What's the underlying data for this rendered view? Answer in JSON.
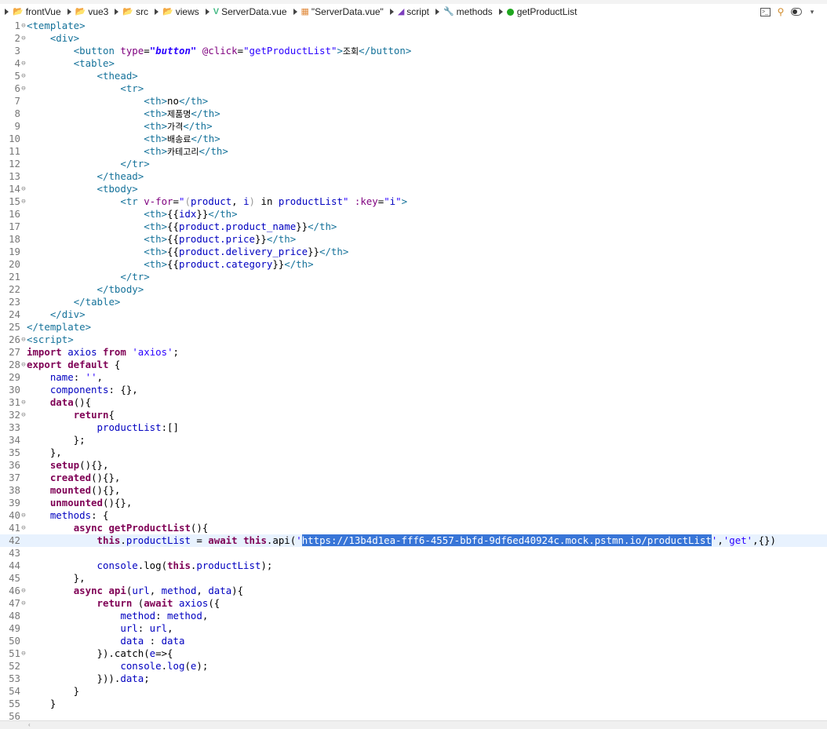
{
  "breadcrumb": {
    "items": [
      {
        "label": "frontVue",
        "icon": "folder-icon"
      },
      {
        "label": "vue3",
        "icon": "folder-icon"
      },
      {
        "label": "src",
        "icon": "folder-icon"
      },
      {
        "label": "views",
        "icon": "folder-icon"
      },
      {
        "label": "ServerData.vue",
        "icon": "vue-file-icon"
      },
      {
        "label": "\"ServerData.vue\"",
        "icon": "grid-file-icon"
      },
      {
        "label": "script",
        "icon": "script-icon"
      },
      {
        "label": "methods",
        "icon": "wrench-icon"
      },
      {
        "label": "getProductList",
        "icon": "method-icon"
      }
    ]
  },
  "toolbar": {
    "icons": [
      "terminal-icon",
      "overlay-icon",
      "toggle-icon",
      "chevron-down-icon"
    ]
  },
  "editor": {
    "current_line": 42,
    "lines": [
      {
        "n": "1",
        "fold": true,
        "html": "<span class='tok-tag'>&lt;template&gt;</span>"
      },
      {
        "n": "2",
        "fold": true,
        "html": "    <span class='tok-tag'>&lt;div&gt;</span>"
      },
      {
        "n": "3",
        "fold": false,
        "html": "        <span class='tok-tag'>&lt;button</span> <span class='tok-attr'>type</span>=<span class='tok-strit'>\"button\"</span> <span class='tok-attr'>@click</span>=<span class='tok-str'>\"getProductList\"</span><span class='tok-tag'>&gt;</span><span class='tok-ko'>조회</span><span class='tok-tag'>&lt;/button&gt;</span>"
      },
      {
        "n": "4",
        "fold": true,
        "html": "        <span class='tok-tag'>&lt;table&gt;</span>"
      },
      {
        "n": "5",
        "fold": true,
        "html": "            <span class='tok-tag'>&lt;thead&gt;</span>"
      },
      {
        "n": "6",
        "fold": true,
        "html": "                <span class='tok-tag'>&lt;tr&gt;</span>"
      },
      {
        "n": "7",
        "fold": false,
        "html": "                    <span class='tok-tag'>&lt;th&gt;</span>no<span class='tok-tag'>&lt;/th&gt;</span>"
      },
      {
        "n": "8",
        "fold": false,
        "html": "                    <span class='tok-tag'>&lt;th&gt;</span><span class='tok-ko'>제품명</span><span class='tok-tag'>&lt;/th&gt;</span>"
      },
      {
        "n": "9",
        "fold": false,
        "html": "                    <span class='tok-tag'>&lt;th&gt;</span><span class='tok-ko'>가격</span><span class='tok-tag'>&lt;/th&gt;</span>"
      },
      {
        "n": "10",
        "fold": false,
        "html": "                    <span class='tok-tag'>&lt;th&gt;</span><span class='tok-ko'>배송료</span><span class='tok-tag'>&lt;/th&gt;</span>"
      },
      {
        "n": "11",
        "fold": false,
        "html": "                    <span class='tok-tag'>&lt;th&gt;</span><span class='tok-ko'>카테고리</span><span class='tok-tag'>&lt;/th&gt;</span>"
      },
      {
        "n": "12",
        "fold": false,
        "html": "                <span class='tok-tag'>&lt;/tr&gt;</span>"
      },
      {
        "n": "13",
        "fold": false,
        "html": "            <span class='tok-tag'>&lt;/thead&gt;</span>"
      },
      {
        "n": "14",
        "fold": true,
        "html": "            <span class='tok-tag'>&lt;tbody&gt;</span>"
      },
      {
        "n": "15",
        "fold": true,
        "html": "                <span class='tok-tag'>&lt;tr</span> <span class='tok-attr'>v-for</span>=<span class='tok-str'>\"</span><span class='tok-dim'>(</span><span class='tok-prop'>product</span>, <span class='tok-prop'>i</span><span class='tok-dim'>)</span> <span class='tok-plain'>in</span> <span class='tok-prop'>productList</span><span class='tok-str'>\"</span> <span class='tok-attr'>:key</span>=<span class='tok-str'>\"</span><span class='tok-prop'>i</span><span class='tok-str'>\"</span><span class='tok-tag'>&gt;</span>"
      },
      {
        "n": "16",
        "fold": false,
        "html": "                    <span class='tok-tag'>&lt;th&gt;</span>{{<span class='tok-prop'>idx</span>}}<span class='tok-tag'>&lt;/th&gt;</span>"
      },
      {
        "n": "17",
        "fold": false,
        "html": "                    <span class='tok-tag'>&lt;th&gt;</span>{{<span class='tok-prop'>product.product_name</span>}}<span class='tok-tag'>&lt;/th&gt;</span>"
      },
      {
        "n": "18",
        "fold": false,
        "html": "                    <span class='tok-tag'>&lt;th&gt;</span>{{<span class='tok-prop'>product.price</span>}}<span class='tok-tag'>&lt;/th&gt;</span>"
      },
      {
        "n": "19",
        "fold": false,
        "html": "                    <span class='tok-tag'>&lt;th&gt;</span>{{<span class='tok-prop'>product.delivery_price</span>}}<span class='tok-tag'>&lt;/th&gt;</span>"
      },
      {
        "n": "20",
        "fold": false,
        "html": "                    <span class='tok-tag'>&lt;th&gt;</span>{{<span class='tok-prop'>product.category</span>}}<span class='tok-tag'>&lt;/th&gt;</span>"
      },
      {
        "n": "21",
        "fold": false,
        "html": "                <span class='tok-tag'>&lt;/tr&gt;</span>"
      },
      {
        "n": "22",
        "fold": false,
        "html": "            <span class='tok-tag'>&lt;/tbody&gt;</span>"
      },
      {
        "n": "23",
        "fold": false,
        "html": "        <span class='tok-tag'>&lt;/table&gt;</span>"
      },
      {
        "n": "24",
        "fold": false,
        "html": "    <span class='tok-tag'>&lt;/div&gt;</span>"
      },
      {
        "n": "25",
        "fold": false,
        "html": "<span class='tok-tag'>&lt;/template&gt;</span>"
      },
      {
        "n": "26",
        "fold": true,
        "html": "<span class='tok-tag'>&lt;script&gt;</span>"
      },
      {
        "n": "27",
        "fold": false,
        "html": "<span class='tok-kw'>import</span> <span class='tok-prop'>axios</span> <span class='tok-kw'>from</span> <span class='tok-str'>'axios'</span>;"
      },
      {
        "n": "28",
        "fold": true,
        "html": "<span class='tok-kw'>export default</span> {"
      },
      {
        "n": "29",
        "fold": false,
        "html": "    <span class='tok-prop'>name</span>: <span class='tok-str'>''</span>,"
      },
      {
        "n": "30",
        "fold": false,
        "html": "    <span class='tok-prop'>components</span>: {},"
      },
      {
        "n": "31",
        "fold": true,
        "html": "    <span class='tok-kw'>data</span>(){"
      },
      {
        "n": "32",
        "fold": true,
        "html": "        <span class='tok-kw'>return</span>{"
      },
      {
        "n": "33",
        "fold": false,
        "html": "            <span class='tok-prop'>productList</span>:[]"
      },
      {
        "n": "34",
        "fold": false,
        "html": "        };"
      },
      {
        "n": "35",
        "fold": false,
        "html": "    },"
      },
      {
        "n": "36",
        "fold": false,
        "html": "    <span class='tok-kw'>setup</span>(){},"
      },
      {
        "n": "37",
        "fold": false,
        "html": "    <span class='tok-kw'>created</span>(){},"
      },
      {
        "n": "38",
        "fold": false,
        "html": "    <span class='tok-kw'>mounted</span>(){},"
      },
      {
        "n": "39",
        "fold": false,
        "html": "    <span class='tok-kw'>unmounted</span>(){},"
      },
      {
        "n": "40",
        "fold": true,
        "html": "    <span class='tok-prop'>methods</span>: {"
      },
      {
        "n": "41",
        "fold": true,
        "html": "        <span class='tok-kw'>async</span> <span class='tok-kw'>getProductList</span>(){"
      },
      {
        "n": "42",
        "fold": false,
        "html": "            <span class='tok-kw'>this</span>.<span class='tok-prop'>productList</span> = <span class='tok-kw'>await</span> <span class='tok-kw'>this</span>.api(<span class='tok-str'>'</span><span class='tok-sel'>https://13b4d1ea-fff6-4557-bbfd-9df6ed40924c.mock.pstmn.io/productList</span><span class='tok-str'>'</span>,<span class='tok-str'>'get'</span>,{})"
      },
      {
        "n": "43",
        "fold": false,
        "html": ""
      },
      {
        "n": "44",
        "fold": false,
        "html": "            <span class='tok-prop'>console</span>.log(<span class='tok-kw'>this</span>.<span class='tok-prop'>productList</span>);"
      },
      {
        "n": "45",
        "fold": false,
        "html": "        },"
      },
      {
        "n": "46",
        "fold": true,
        "html": "        <span class='tok-kw'>async</span> <span class='tok-kw'>api</span>(<span class='tok-prop'>url</span>, <span class='tok-prop'>method</span>, <span class='tok-prop'>data</span>){"
      },
      {
        "n": "47",
        "fold": true,
        "html": "            <span class='tok-kw'>return</span> (<span class='tok-kw'>await</span> <span class='tok-prop'>axios</span>({"
      },
      {
        "n": "48",
        "fold": false,
        "html": "                <span class='tok-prop'>method</span>: <span class='tok-prop'>method</span>,"
      },
      {
        "n": "49",
        "fold": false,
        "html": "                <span class='tok-prop'>url</span>: <span class='tok-prop'>url</span>,"
      },
      {
        "n": "50",
        "fold": false,
        "html": "                <span class='tok-prop'>data</span> : <span class='tok-prop'>data</span>"
      },
      {
        "n": "51",
        "fold": true,
        "html": "            }).catch(<span class='tok-prop'>e</span>=&gt;{"
      },
      {
        "n": "52",
        "fold": false,
        "html": "                <span class='tok-prop'>console</span>.<span class='tok-prop'>log</span>(<span class='tok-prop'>e</span>);"
      },
      {
        "n": "53",
        "fold": false,
        "html": "            })).<span class='tok-prop'>data</span>;"
      },
      {
        "n": "54",
        "fold": false,
        "html": "        }"
      },
      {
        "n": "55",
        "fold": false,
        "html": "    }"
      },
      {
        "n": "56",
        "fold": false,
        "html": ""
      }
    ]
  }
}
